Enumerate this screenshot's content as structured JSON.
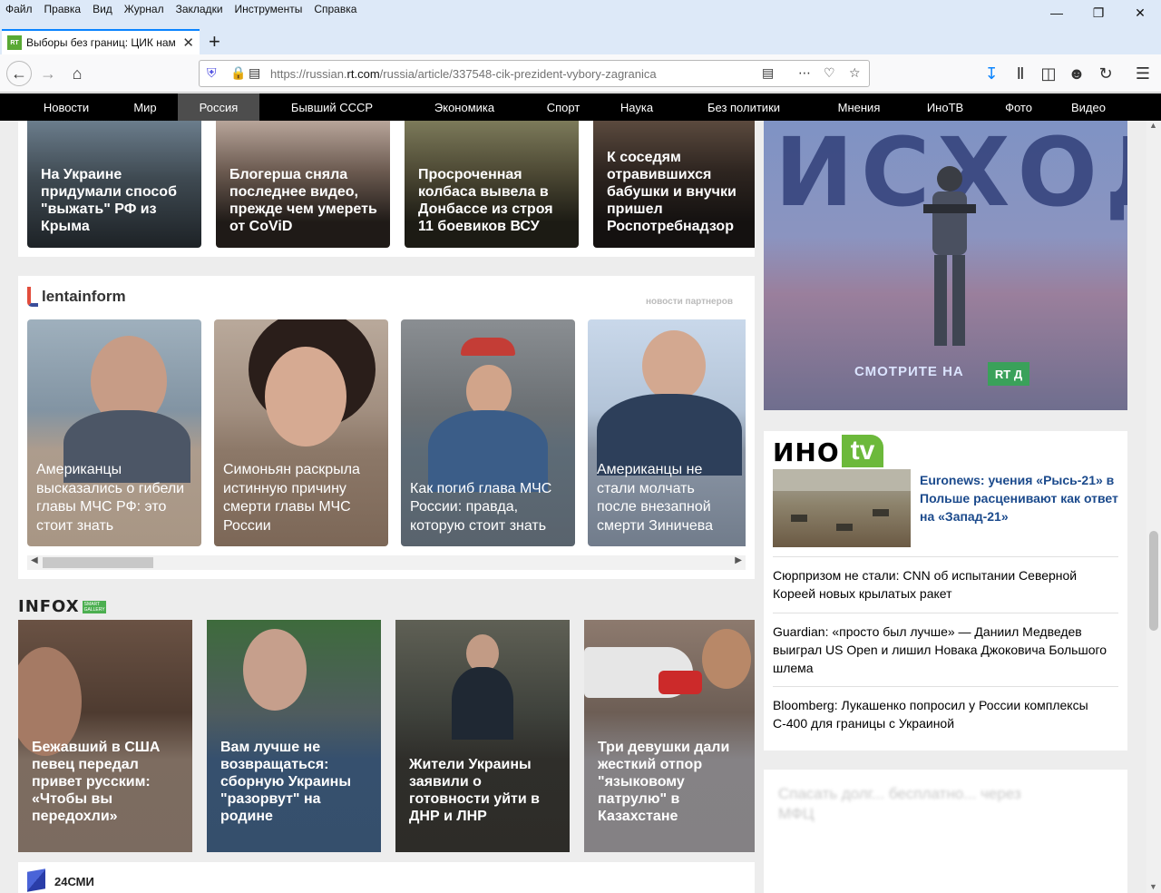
{
  "browser": {
    "menu": [
      "Файл",
      "Правка",
      "Вид",
      "Журнал",
      "Закладки",
      "Инструменты",
      "Справка"
    ],
    "tab_title": "Выборы без границ: ЦИК нам",
    "tab_favicon": "RT",
    "url_host_prefix": "https://russian.",
    "url_host": "rt.com",
    "url_path": "/russia/article/337548-cik-prezident-vybory-zagranica"
  },
  "sitenav": [
    "Новости",
    "Мир",
    "Россия",
    "Бывший СССР",
    "Экономика",
    "Спорт",
    "Наука",
    "Без политики",
    "Мнения",
    "ИноТВ",
    "Фото",
    "Видео"
  ],
  "top_cards": [
    "На Украине придумали способ \"выжать\" РФ из Крыма",
    "Блогерша сняла последнее видео, прежде чем умереть от CoViD",
    "Просроченная колбаса вывела в Донбассе из строя 11 боевиков ВСУ",
    "К соседям отравившихся бабушки и внучки пришел Роспотребнадзор"
  ],
  "lentainform": {
    "logo": "lentainform",
    "partners": "новости партнеров",
    "cards": [
      "Американцы высказались о гибели главы МЧС РФ: это стоит знать",
      "Симоньян раскрыла истинную причину смерти главы МЧС России",
      "Как погиб глава МЧС России: правда, которую стоит знать",
      "Американцы не стали молчать после внезапной смерти Зиничева"
    ]
  },
  "infox": {
    "logo": "INFOX",
    "badge": "SMART GALLERY",
    "cards": [
      "Бежавший в США певец передал привет русским: «Чтобы вы передохли»",
      "Вам лучше не возвращаться: сборную Украины \"разорвут\" на родине",
      "Жители Украины заявили о готовности уйти в ДНР и ЛНР",
      "Три девушки дали жесткий отпор \"языковому патрулю\" в Казахстане"
    ]
  },
  "smi": {
    "label": "24СМИ"
  },
  "promo": {
    "big_text": "ИСХОД",
    "watch": "СМОТРИТЕ НА",
    "channel": "RT Д"
  },
  "inotv": {
    "logo_ino": "ИНО",
    "logo_tv": "tv",
    "lead": "Euronews: учения «Рысь-21» в Польше расценивают как ответ на «Запад-21»",
    "items": [
      "Сюрпризом не стали: CNN об испытании Северной Кореей новых крылатых ракет",
      "Guardian: «просто был лучше» — Даниил Медведев выиграл US Open и лишил Новака Джоковича Большого шлема",
      "Bloomberg: Лукашенко попросил у России комплексы С-400 для границы с Украиной"
    ]
  },
  "blurred": "Спасать долг... бесплатно... через МФЦ",
  "colors": {
    "accent_green": "#6cb93b",
    "nav_bg": "#000000",
    "nav_active": "#4d4d4d",
    "link_blue": "#1b4a8c"
  }
}
